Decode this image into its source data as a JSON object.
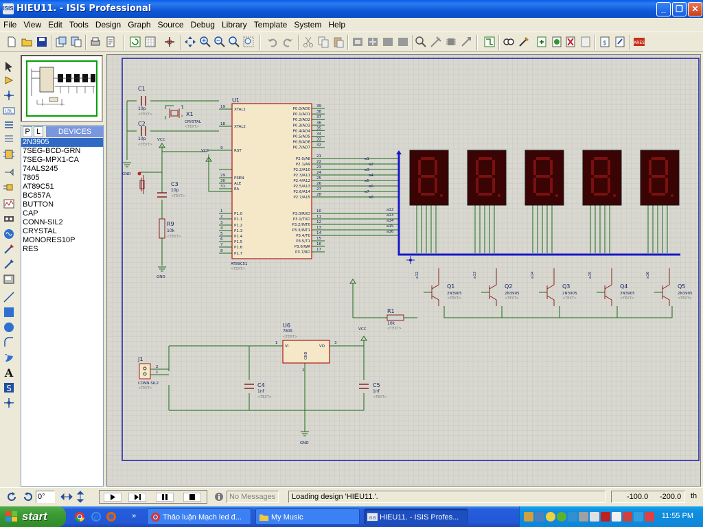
{
  "window": {
    "title": "HIEU11. - ISIS Professional",
    "app_icon_text": "ISIS",
    "controls": [
      "minimize",
      "maximize",
      "close"
    ]
  },
  "menu": [
    "File",
    "View",
    "Edit",
    "Tools",
    "Design",
    "Graph",
    "Source",
    "Debug",
    "Library",
    "Template",
    "System",
    "Help"
  ],
  "device_panel": {
    "tabs": [
      "P",
      "L"
    ],
    "title": "DEVICES",
    "items": [
      "2N3905",
      "7SEG-BCD-GRN",
      "7SEG-MPX1-CA",
      "74ALS245",
      "7805",
      "AT89C51",
      "BC857A",
      "BUTTON",
      "CAP",
      "CONN-SIL2",
      "CRYSTAL",
      "MONORES10P",
      "RES"
    ],
    "selected": "2N3905"
  },
  "schematic": {
    "labels": {
      "c1": "C1",
      "c1v": "10p",
      "c2": "C2",
      "c2v": "10p",
      "x1": "X1",
      "x1v": "CRYSTAL",
      "c3": "C3",
      "c3v": "10p",
      "r9": "R9",
      "r9v": "10k",
      "u1": "U1",
      "u1part": "AT89C51",
      "u6": "U6",
      "u6part": "7805",
      "c4": "C4",
      "c4v": "1nf",
      "c5": "C5",
      "c5v": "1nf",
      "j1": "J1",
      "j1part": "CONN-SIL2",
      "r1": "R1",
      "r1v": "10k",
      "vcc": "VCC",
      "gnd": "GND",
      "text": "<TEXT>",
      "vi": "VI",
      "vo": "VO",
      "gndpin": "GND"
    },
    "left_pins": [
      "XTAL1",
      "XTAL2",
      "RST",
      "PSEN",
      "ALE",
      "EA",
      "P1.0",
      "P1.1",
      "P1.2",
      "P1.3",
      "P1.4",
      "P1.5",
      "P1.6",
      "P1.7"
    ],
    "left_pin_nums": [
      "19",
      "18",
      "9",
      "29",
      "30",
      "31",
      "1",
      "2",
      "3",
      "4",
      "5",
      "6",
      "7",
      "8"
    ],
    "right_pins": [
      "P0.0/AD0",
      "P0.1/AD1",
      "P0.2/AD2",
      "P0.3/AD3",
      "P0.4/AD4",
      "P0.5/AD5",
      "P0.6/AD6",
      "P0.7/AD7",
      "P2.0/A8",
      "P2.1/A9",
      "P2.2/A10",
      "P2.3/A11",
      "P2.4/A12",
      "P2.5/A13",
      "P2.6/A14",
      "P2.7/A15",
      "P3.0/RXD",
      "P3.1/TXD",
      "P3.2/INT0",
      "P3.3/INT1",
      "P3.4/T0",
      "P3.5/T1",
      "P3.6/WR",
      "P3.7/RD"
    ],
    "right_pin_nums": [
      "39",
      "38",
      "37",
      "36",
      "35",
      "34",
      "33",
      "32",
      "21",
      "22",
      "23",
      "24",
      "25",
      "26",
      "27",
      "28",
      "10",
      "11",
      "12",
      "13",
      "14",
      "15",
      "16",
      "17"
    ],
    "bus_labels": [
      "a1",
      "a2",
      "a3",
      "a4",
      "a5",
      "a6",
      "a7",
      "a8",
      "a12",
      "a13",
      "a14",
      "a15",
      "a16"
    ],
    "transistors": [
      {
        "name": "Q1",
        "part": "2N3905",
        "base": "a12"
      },
      {
        "name": "Q2",
        "part": "2N3905",
        "base": "a13"
      },
      {
        "name": "Q3",
        "part": "2N3905",
        "base": "a14"
      },
      {
        "name": "Q4",
        "part": "2N3905",
        "base": "a15"
      },
      {
        "name": "Q5",
        "part": "2N3905",
        "base": "a16"
      }
    ],
    "j1_pins": [
      "2",
      "1"
    ],
    "u6_pins": [
      "1",
      "3",
      "2"
    ]
  },
  "status": {
    "rotation": "0°",
    "messages": "No Messages",
    "status_text": "Loading design 'HIEU11.'.",
    "coord_x": "-100.0",
    "coord_y": "-200.0",
    "unit": "th"
  },
  "taskbar": {
    "start": "start",
    "tasks": [
      {
        "label": "Thảo luận Mạch led đ...",
        "active": false
      },
      {
        "label": "My Music",
        "active": false
      },
      {
        "label": "HIEU11. - ISIS Profes...",
        "active": true
      }
    ],
    "clock": "11:55 PM"
  },
  "colors": {
    "accent_blue": "#0a5ee8",
    "segment_red": "#6a0808",
    "wire_green": "#1a6a1a",
    "bus_blue": "#1818c8",
    "chip_fill": "#f4e8c8",
    "chip_border": "#b01818"
  }
}
